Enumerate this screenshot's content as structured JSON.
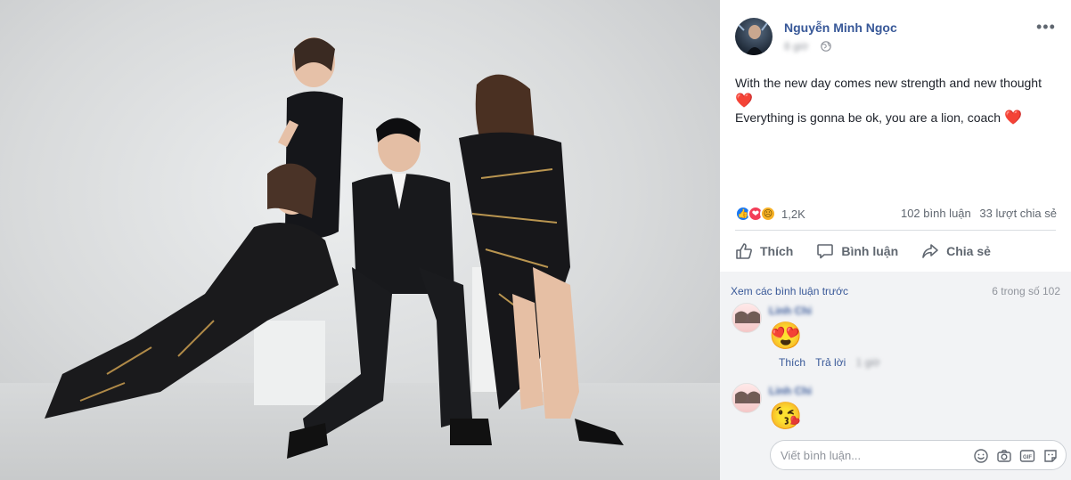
{
  "post": {
    "author": "Nguyễn Minh Ngọc",
    "time": "8 giờ",
    "text_line1": "With the new day comes new strength and new thought",
    "text_line2": "Everything is gonna be ok, you are a lion, coach",
    "heart": "❤️"
  },
  "reactions": {
    "count": "1,2K"
  },
  "stats": {
    "comments": "102 bình luận",
    "shares": "33 lượt chia sẻ"
  },
  "actions": {
    "like": "Thích",
    "comment": "Bình luận",
    "share": "Chia sẻ"
  },
  "comments": {
    "view_previous": "Xem các bình luận trước",
    "count_of": "6 trong số 102",
    "items": [
      {
        "name": "Linh Chi",
        "emoji": "😍",
        "like": "Thích",
        "reply": "Trả lời",
        "time": "1 giờ"
      },
      {
        "name": "Linh Chi",
        "emoji": "😘"
      }
    ]
  },
  "composer": {
    "placeholder": "Viết bình luận..."
  },
  "colors": {
    "link": "#385898",
    "like_blue": "#1877f2",
    "love_red": "#f33e58"
  }
}
